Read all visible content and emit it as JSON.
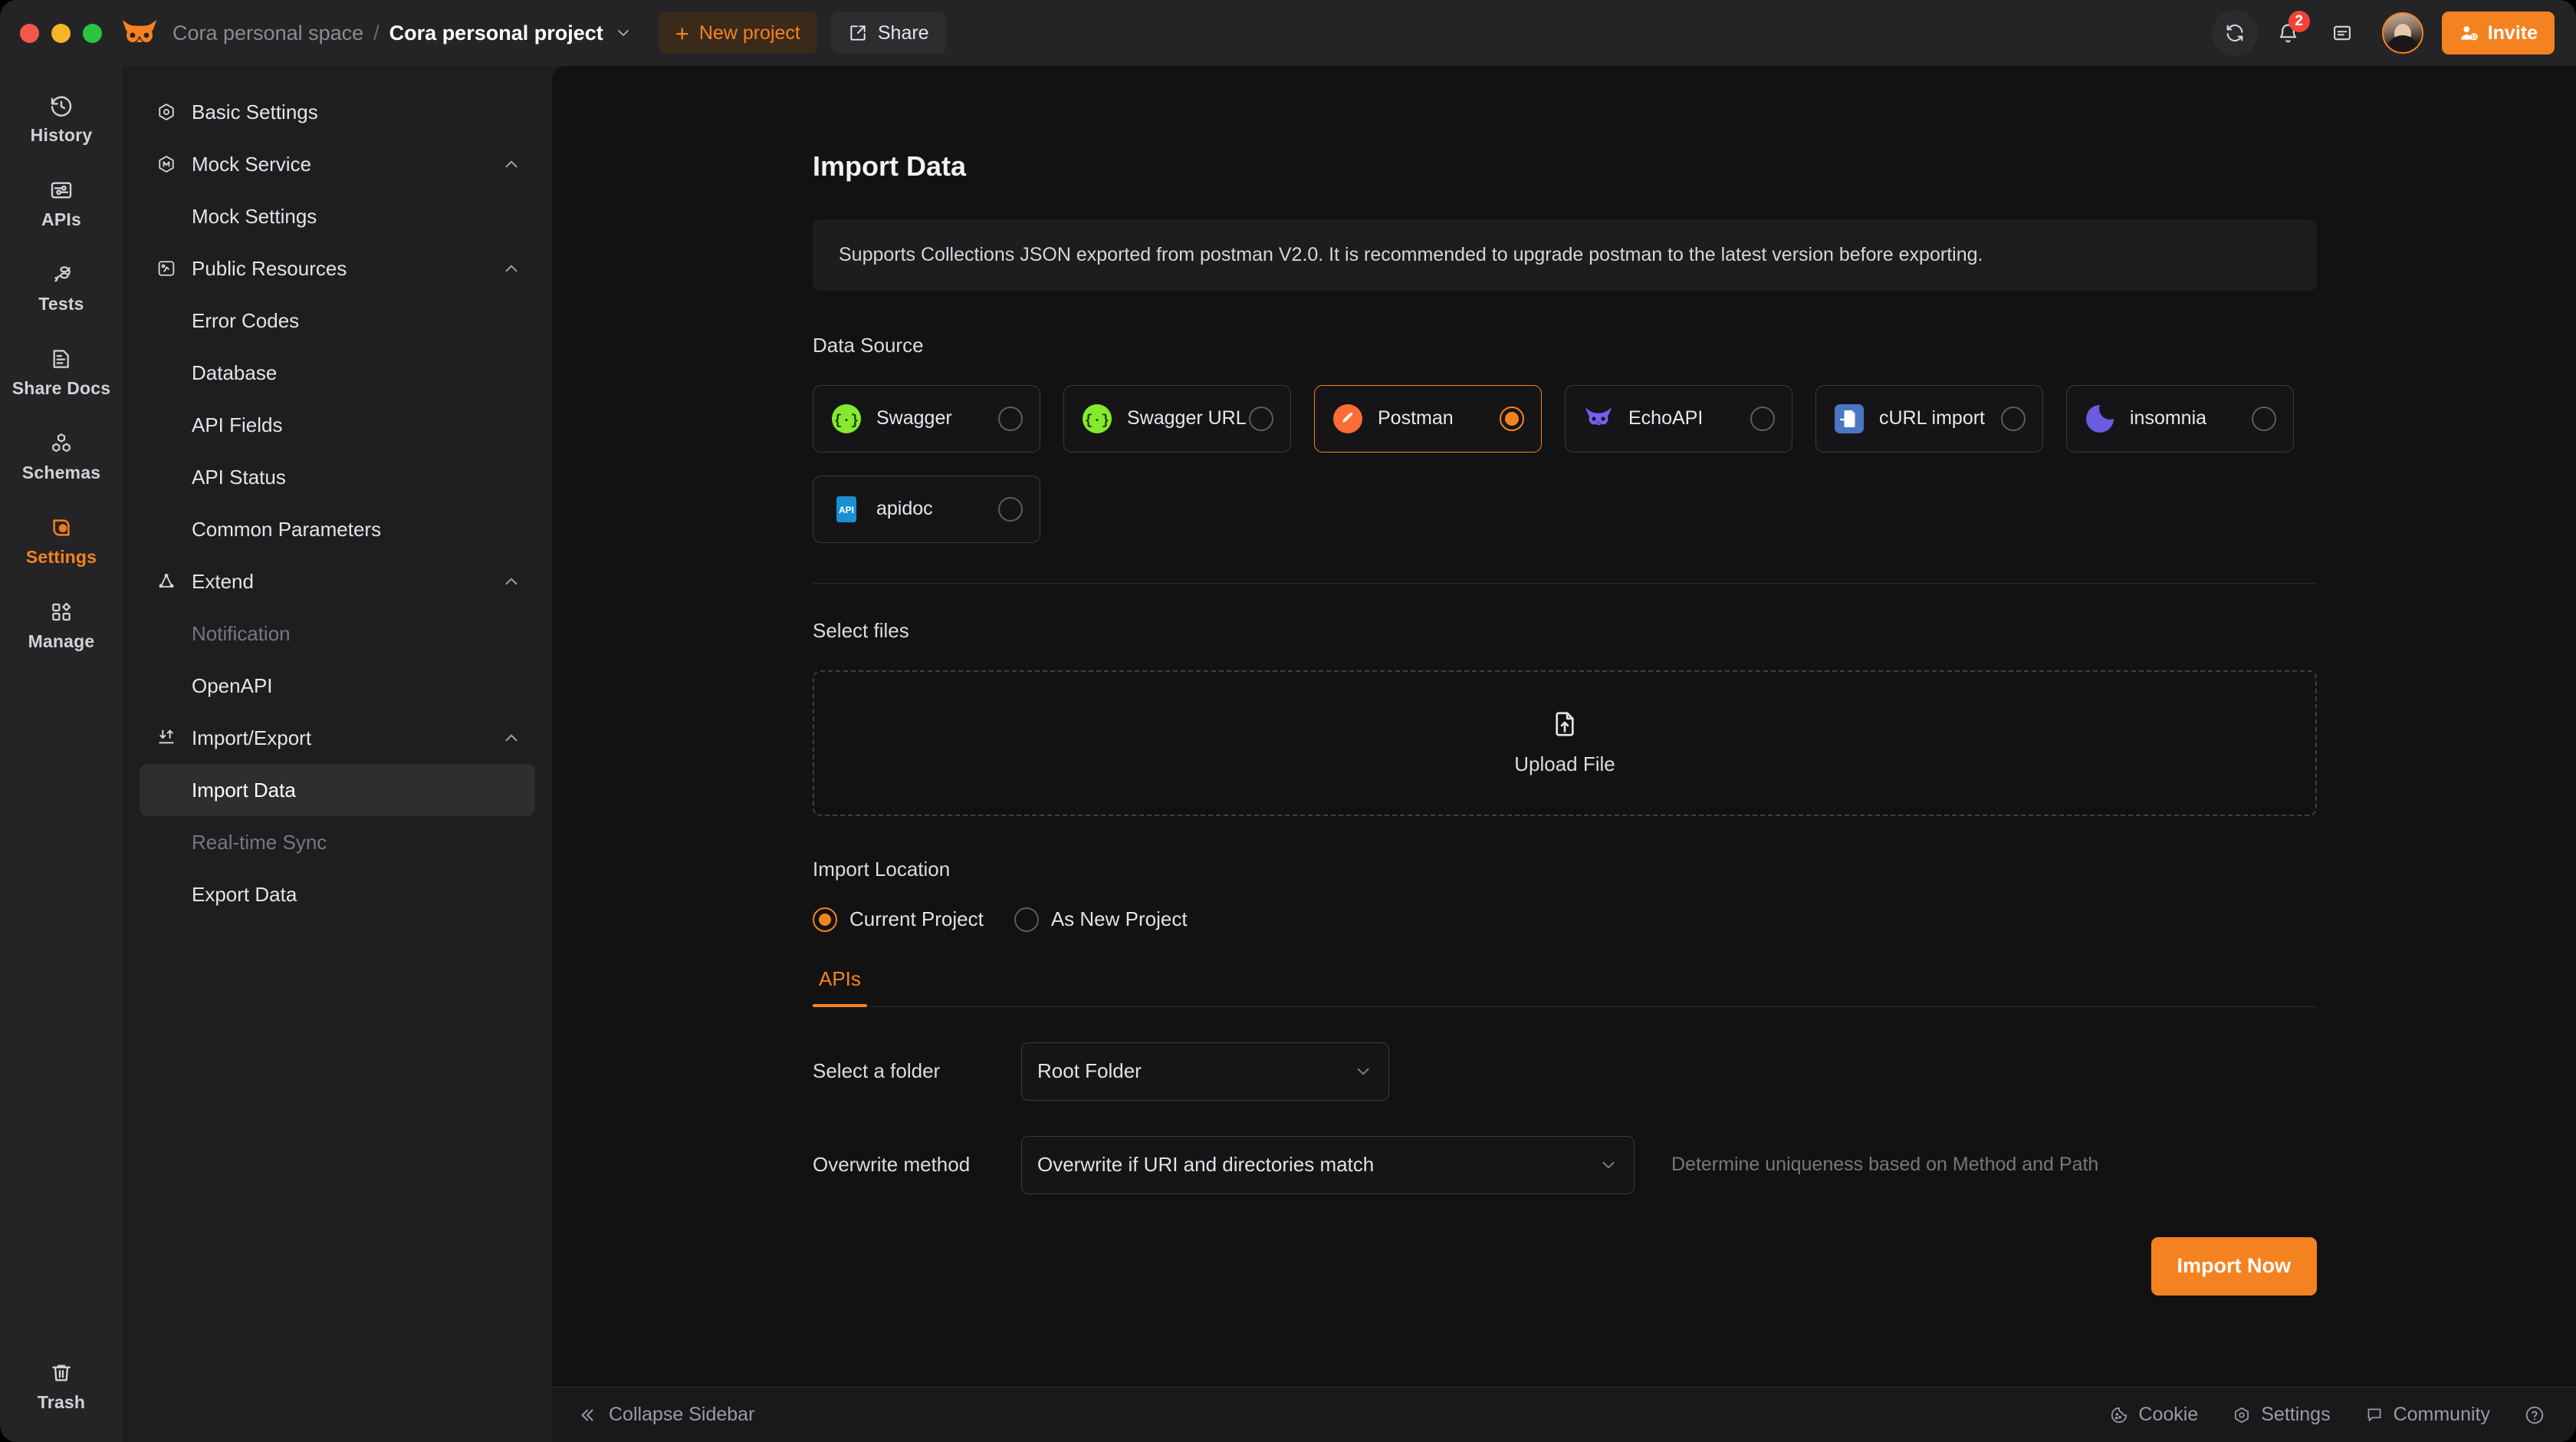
{
  "window": {
    "traffic_lights": [
      "close",
      "minimize",
      "zoom"
    ],
    "brand_icon": "owl-logo-icon",
    "breadcrumb_space": "Cora personal space",
    "breadcrumb_separator": "/",
    "breadcrumb_project": "Cora personal project",
    "new_project_label": "New project",
    "share_label": "Share",
    "invite_label": "Invite",
    "notification_count": "2"
  },
  "rail": {
    "items": [
      {
        "label": "History",
        "icon": "history-clock-icon",
        "active": false
      },
      {
        "label": "APIs",
        "icon": "apis-sliders-icon",
        "active": false
      },
      {
        "label": "Tests",
        "icon": "tests-flow-icon",
        "active": false
      },
      {
        "label": "Share Docs",
        "icon": "share-docs-icon",
        "active": false
      },
      {
        "label": "Schemas",
        "icon": "schemas-hexagons-icon",
        "active": false
      },
      {
        "label": "Settings",
        "icon": "settings-eye-icon",
        "active": true
      },
      {
        "label": "Manage",
        "icon": "manage-shapes-icon",
        "active": false
      }
    ],
    "trash_label": "Trash",
    "trash_icon": "trash-icon"
  },
  "sidebar": {
    "nav": [
      {
        "type": "group",
        "label": "Basic Settings",
        "icon": "hexagon-dot-icon",
        "collapsible": false
      },
      {
        "type": "group",
        "label": "Mock Service",
        "icon": "mock-hexagon-icon",
        "collapsible": true
      },
      {
        "type": "child",
        "label": "Mock Settings",
        "state": "normal"
      },
      {
        "type": "group",
        "label": "Public Resources",
        "icon": "public-resources-icon",
        "collapsible": true
      },
      {
        "type": "child",
        "label": "Error Codes",
        "state": "normal"
      },
      {
        "type": "child",
        "label": "Database",
        "state": "normal"
      },
      {
        "type": "child",
        "label": "API Fields",
        "state": "normal"
      },
      {
        "type": "child",
        "label": "API Status",
        "state": "normal"
      },
      {
        "type": "child",
        "label": "Common Parameters",
        "state": "normal"
      },
      {
        "type": "group",
        "label": "Extend",
        "icon": "extend-share-icon",
        "collapsible": true
      },
      {
        "type": "child",
        "label": "Notification",
        "state": "dim"
      },
      {
        "type": "child",
        "label": "OpenAPI",
        "state": "normal"
      },
      {
        "type": "group",
        "label": "Import/Export",
        "icon": "import-export-icon",
        "collapsible": true
      },
      {
        "type": "child",
        "label": "Import Data",
        "state": "active"
      },
      {
        "type": "child",
        "label": "Real-time Sync",
        "state": "dim"
      },
      {
        "type": "child",
        "label": "Export Data",
        "state": "normal"
      }
    ]
  },
  "main": {
    "title": "Import Data",
    "notice": "Supports Collections JSON exported from postman V2.0. It is recommended to upgrade postman to the latest version before exporting.",
    "data_source_label": "Data Source",
    "data_sources": [
      {
        "name": "Swagger",
        "icon": "swagger-icon",
        "selected": false
      },
      {
        "name": "Swagger URL",
        "icon": "swagger-url-icon",
        "selected": false
      },
      {
        "name": "Postman",
        "icon": "postman-icon",
        "selected": true
      },
      {
        "name": "EchoAPI",
        "icon": "echoapi-owl-icon",
        "selected": false
      },
      {
        "name": "cURL import",
        "icon": "curl-import-icon",
        "selected": false
      },
      {
        "name": "insomnia",
        "icon": "insomnia-icon",
        "selected": false
      },
      {
        "name": "apidoc",
        "icon": "apidoc-icon",
        "selected": false
      }
    ],
    "select_files_label": "Select files",
    "upload_label": "Upload File",
    "upload_icon": "file-upload-icon",
    "import_location_label": "Import Location",
    "import_location_options": [
      {
        "label": "Current Project",
        "selected": true
      },
      {
        "label": "As New Project",
        "selected": false
      }
    ],
    "tabs": [
      {
        "label": "APIs",
        "active": true
      }
    ],
    "folder_label": "Select a folder",
    "folder_value": "Root Folder",
    "overwrite_label": "Overwrite method",
    "overwrite_value": "Overwrite if URI and directories match",
    "overwrite_hint": "Determine uniqueness based on Method and Path",
    "import_button_label": "Import Now"
  },
  "footer": {
    "collapse_label": "Collapse Sidebar",
    "collapse_icon": "chevron-double-left-icon",
    "items": [
      {
        "label": "Cookie",
        "icon": "cookie-icon"
      },
      {
        "label": "Settings",
        "icon": "gear-hexagon-icon"
      },
      {
        "label": "Community",
        "icon": "chat-bubble-icon"
      }
    ],
    "help_icon": "help-circle-icon"
  },
  "colors": {
    "accent": "#f58220",
    "window_bg": "#1e1e20",
    "main_bg": "#121212",
    "titlebar_bg": "#242426",
    "badge": "#f04438"
  }
}
